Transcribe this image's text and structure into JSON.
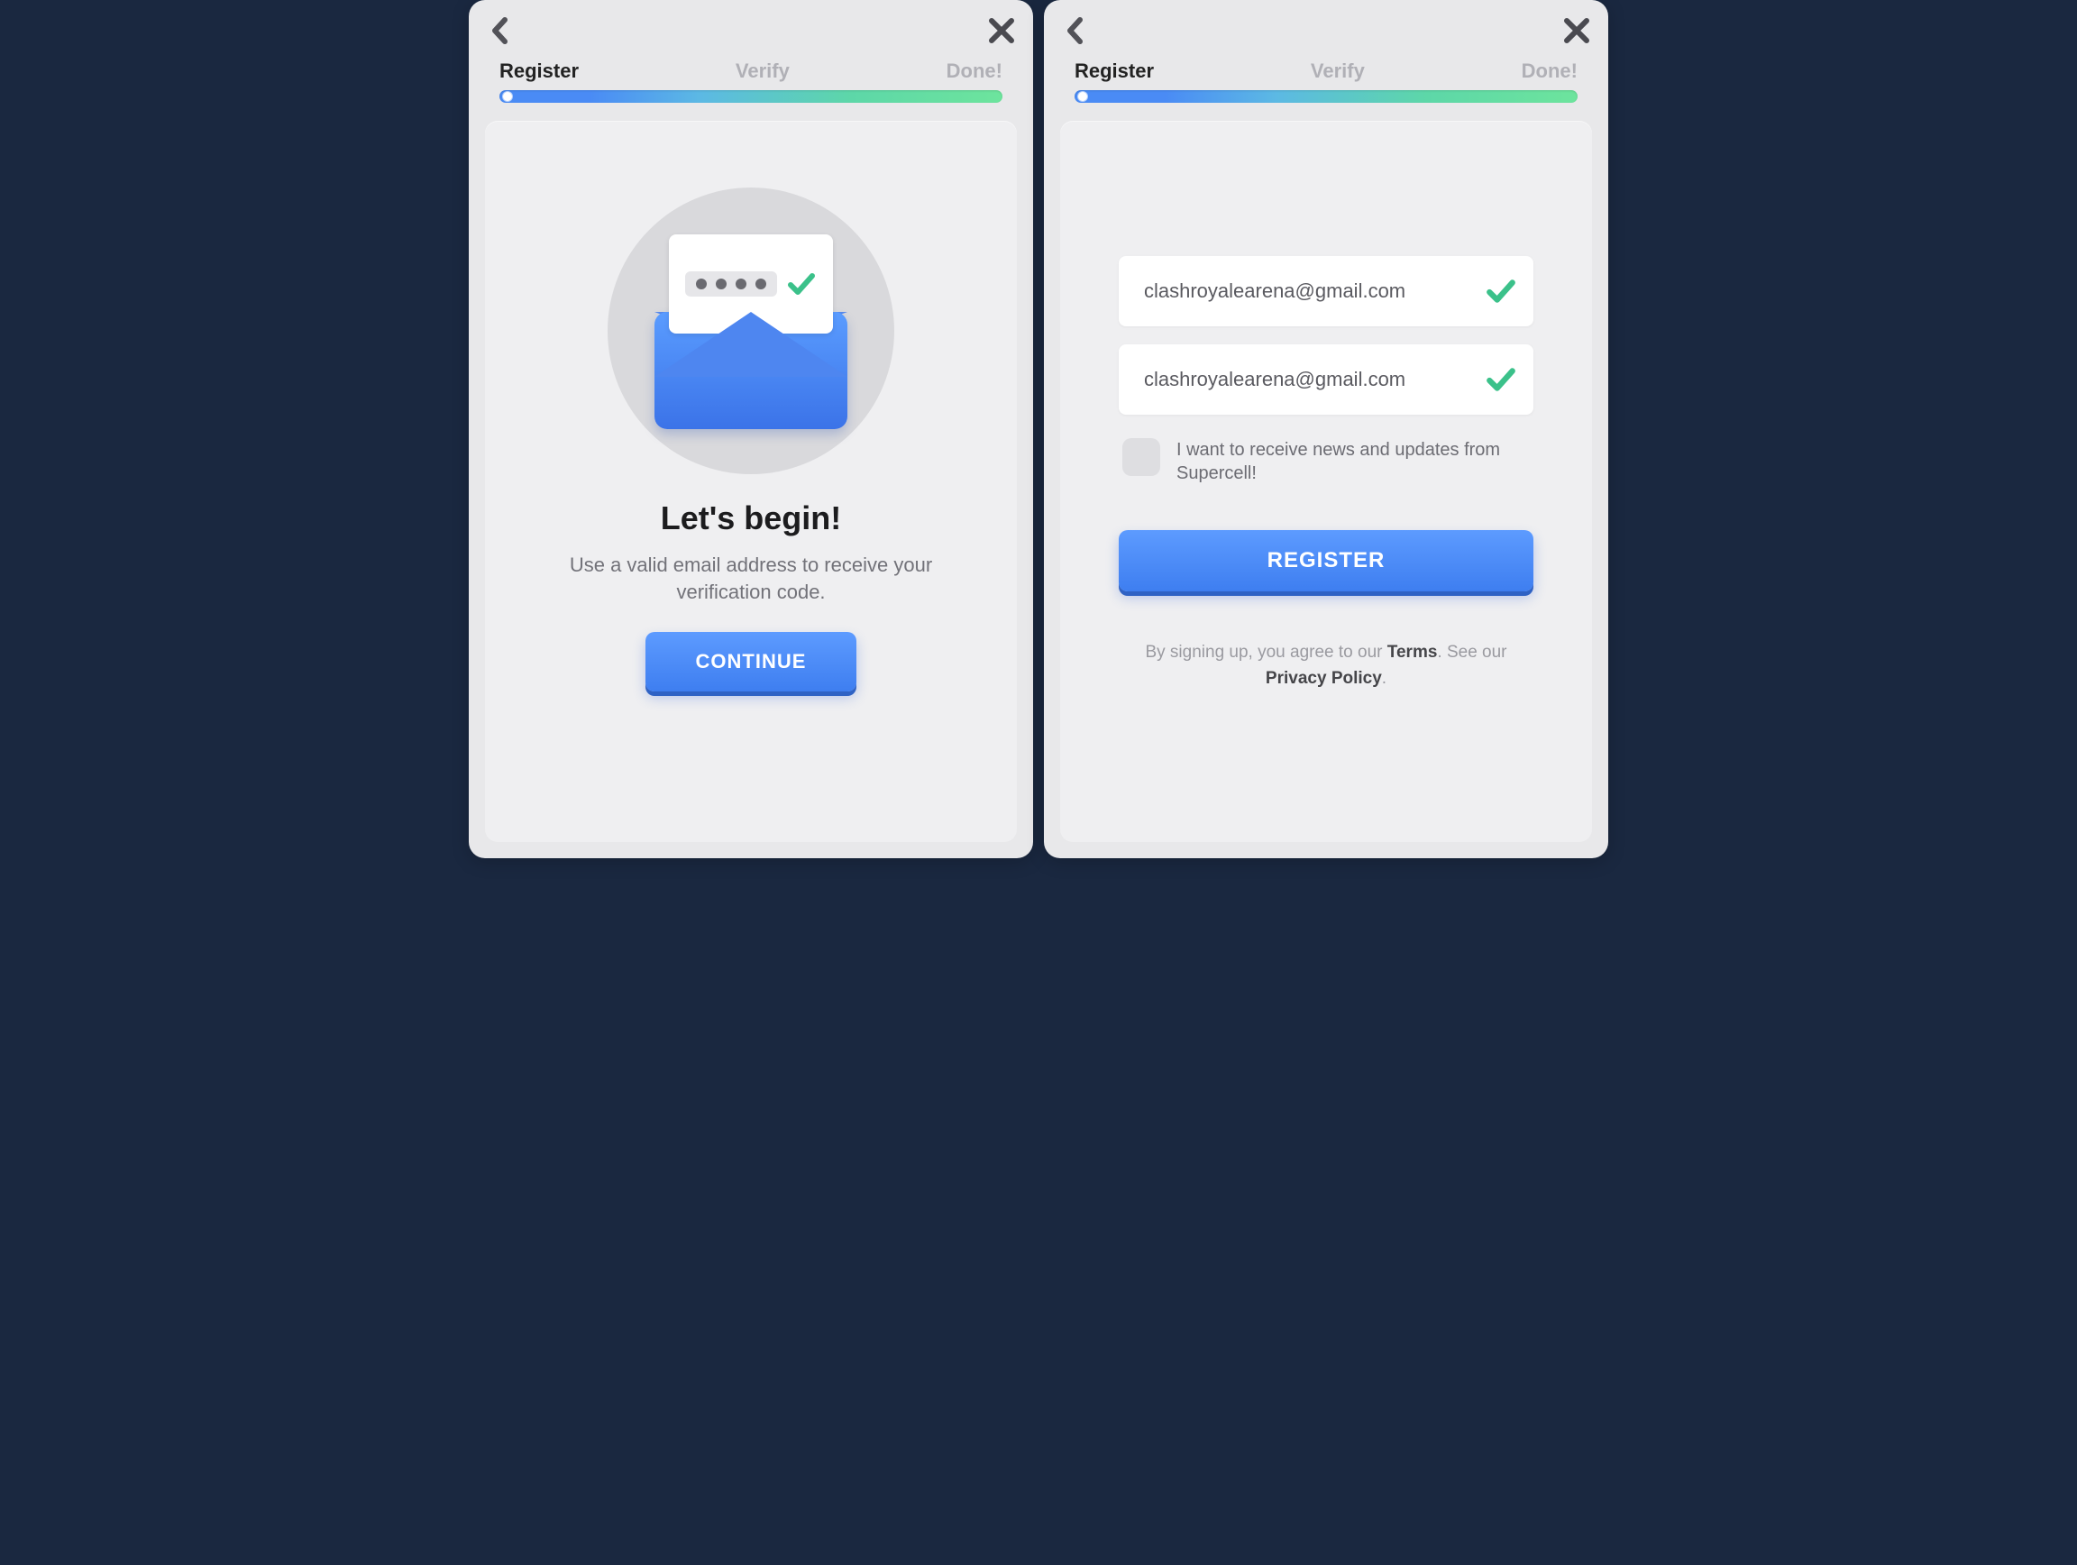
{
  "steps": {
    "register": "Register",
    "verify": "Verify",
    "done": "Done!"
  },
  "left": {
    "headline": "Let's begin!",
    "subtext": "Use a valid email address to receive your verification code.",
    "button": "CONTINUE"
  },
  "right": {
    "email_value": "clashroyalearena@gmail.com",
    "email_confirm_value": "clashroyalearena@gmail.com",
    "consent_text": "I want to receive news and updates from Supercell!",
    "button": "REGISTER",
    "legal_prefix": "By signing up, you agree to our ",
    "legal_terms": "Terms",
    "legal_mid": ". See our ",
    "legal_privacy": "Privacy Policy",
    "legal_suffix": "."
  }
}
